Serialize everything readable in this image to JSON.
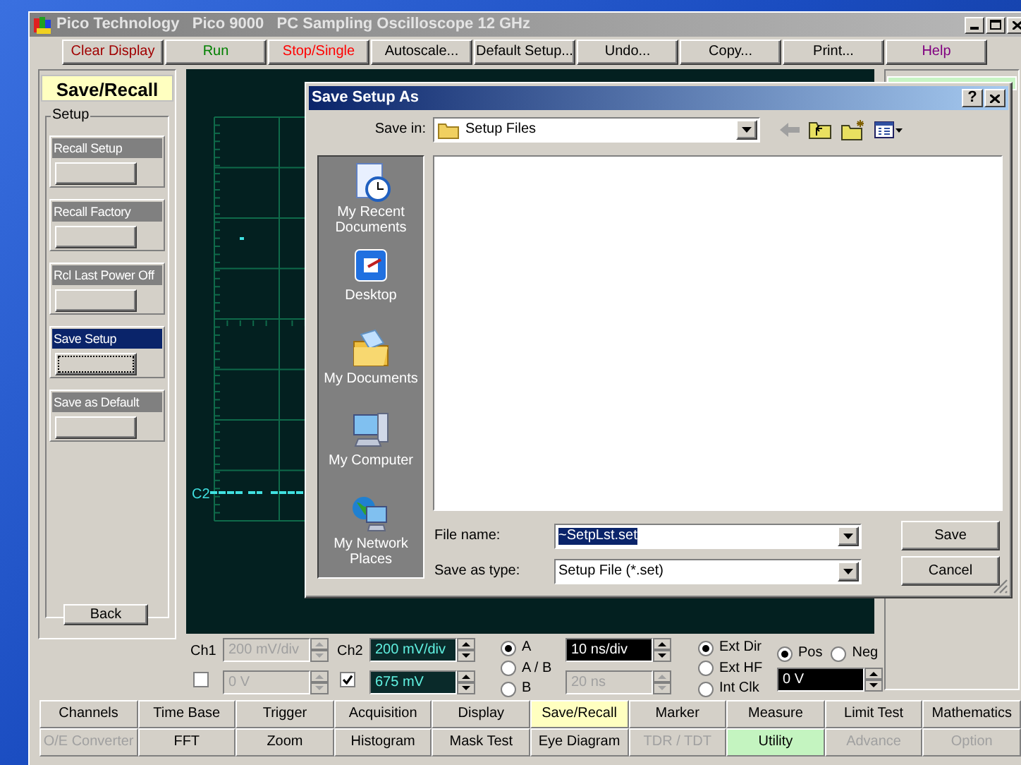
{
  "window": {
    "title": "Pico Technology   Pico 9000   PC Sampling Oscilloscope 12 GHz"
  },
  "toolbar": [
    {
      "label": "Clear Display",
      "color": "#a00000"
    },
    {
      "label": "Run",
      "color": "#008000"
    },
    {
      "label": "Stop/Single",
      "color": "#ff0000"
    },
    {
      "label": "Autoscale...",
      "color": "#000000"
    },
    {
      "label": "Default Setup...",
      "color": "#000000"
    },
    {
      "label": "Undo...",
      "color": "#000000"
    },
    {
      "label": "Copy...",
      "color": "#000000"
    },
    {
      "label": "Print...",
      "color": "#000000"
    },
    {
      "label": "Help",
      "color": "#800080"
    }
  ],
  "side_panel": {
    "title": "Save/Recall",
    "group": "Setup",
    "items": [
      {
        "label": "Recall Setup",
        "selected": false
      },
      {
        "label": "Recall Factory",
        "selected": false
      },
      {
        "label": "Rcl Last Power Off",
        "selected": false
      },
      {
        "label": "Save Setup",
        "selected": true
      },
      {
        "label": "Save as Default",
        "selected": false
      }
    ],
    "back_button": "Back"
  },
  "scope": {
    "trace_label": "C2"
  },
  "controls": {
    "channels": [
      {
        "label": "Ch1",
        "enabled": false,
        "scale": "200 mV/div",
        "offset": "0 V"
      },
      {
        "label": "Ch2",
        "enabled": true,
        "scale": "200 mV/div",
        "offset": "675 mV"
      }
    ],
    "timebase": {
      "modes": [
        {
          "label": "A",
          "selected": true
        },
        {
          "label": "A / B",
          "selected": false
        },
        {
          "label": "B",
          "selected": false
        }
      ],
      "scale": "10 ns/div",
      "delay": "20 ns",
      "delay_disabled": true
    },
    "trigger": {
      "sources": [
        {
          "label": "Ext Dir",
          "selected": true
        },
        {
          "label": "Ext HF",
          "selected": false
        },
        {
          "label": "Int Clk",
          "selected": false
        }
      ],
      "slopes": [
        {
          "label": "Pos",
          "selected": true
        },
        {
          "label": "Neg",
          "selected": false
        }
      ],
      "level": "0 V"
    }
  },
  "menu_rows": [
    {
      "tabs": [
        {
          "label": "Channels",
          "selected": false,
          "disabled": false
        },
        {
          "label": "Time Base",
          "selected": false,
          "disabled": false
        },
        {
          "label": "Trigger",
          "selected": false,
          "disabled": false
        },
        {
          "label": "Acquisition",
          "selected": false,
          "disabled": false
        },
        {
          "label": "Display",
          "selected": false,
          "disabled": false
        },
        {
          "label": "Save/Recall",
          "selected": true,
          "disabled": false,
          "color": "#ffffc0"
        },
        {
          "label": "Marker",
          "selected": false,
          "disabled": false
        },
        {
          "label": "Measure",
          "selected": false,
          "disabled": false
        },
        {
          "label": "Limit Test",
          "selected": false,
          "disabled": false
        },
        {
          "label": "Mathematics",
          "selected": false,
          "disabled": false
        }
      ]
    },
    {
      "tabs": [
        {
          "label": "O/E Converter",
          "selected": false,
          "disabled": true
        },
        {
          "label": "FFT",
          "selected": false,
          "disabled": false
        },
        {
          "label": "Zoom",
          "selected": false,
          "disabled": false
        },
        {
          "label": "Histogram",
          "selected": false,
          "disabled": false
        },
        {
          "label": "Mask Test",
          "selected": false,
          "disabled": false
        },
        {
          "label": "Eye Diagram",
          "selected": false,
          "disabled": false
        },
        {
          "label": "TDR / TDT",
          "selected": false,
          "disabled": true
        },
        {
          "label": "Utility",
          "selected": true,
          "disabled": false,
          "color": "#c4f4c0"
        },
        {
          "label": "Advance",
          "selected": false,
          "disabled": true
        },
        {
          "label": "Option",
          "selected": false,
          "disabled": true
        }
      ]
    }
  ],
  "dialog": {
    "title": "Save Setup As",
    "help_button": "?",
    "save_in_label": "Save in:",
    "save_in": "Setup Files",
    "places": [
      {
        "label": "My Recent Documents",
        "kind": "recent"
      },
      {
        "label": "Desktop",
        "kind": "desktop"
      },
      {
        "label": "My Documents",
        "kind": "documents"
      },
      {
        "label": "My Computer",
        "kind": "computer"
      },
      {
        "label": "My Network Places",
        "kind": "network"
      }
    ],
    "file_name_label": "File name:",
    "file_name": "~SetpLst.set",
    "file_name_selected": true,
    "type_label": "Save as type:",
    "file_type": "Setup File (*.set)",
    "buttons": [
      "Save",
      "Cancel"
    ]
  }
}
